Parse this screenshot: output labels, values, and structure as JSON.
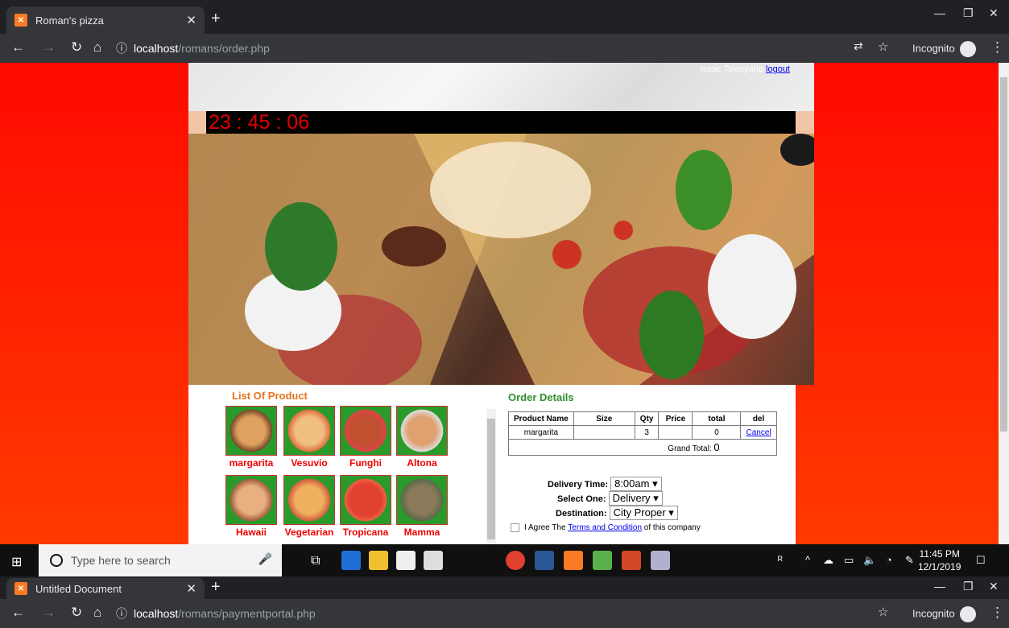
{
  "browser1": {
    "tab_title": "Roman's pizza",
    "url_host": "localhost",
    "url_path": "/romans/order.php",
    "incognito": "Incognito"
  },
  "page": {
    "user_name": "Isaac Tsienyane",
    "logout": "logout",
    "clock": "23 : 45 : 06",
    "list_title": "List Of Product",
    "products": [
      "margarita",
      "Vesuvio",
      "Funghi",
      "Altona",
      "Hawaii",
      "Vegetarian",
      "Tropicana",
      "Mamma"
    ],
    "order_title": "Order Details",
    "table_headers": [
      "Product Name",
      "Size",
      "Qty",
      "Price",
      "total",
      "del"
    ],
    "row": {
      "product": "margarita",
      "size": "",
      "qty": "3",
      "price": "",
      "total": "0",
      "del": "Cancel"
    },
    "grand_total_label": "Grand Total:",
    "grand_total_value": "0",
    "delivery_time_label": "Delivery Time:",
    "delivery_time_value": "8:00am",
    "select_one_label": "Select One:",
    "select_one_value": "Delivery",
    "destination_label": "Destination:",
    "destination_value": "City Proper",
    "agree_prefix": "I Agree The ",
    "agree_link": "Terms and Condition",
    "agree_suffix": " of this company"
  },
  "taskbar": {
    "search_placeholder": "Type here to search",
    "time": "11:45 PM",
    "date": "12/1/2019"
  },
  "browser2": {
    "tab_title": "Untitled Document",
    "url_host": "localhost",
    "url_path": "/romans/paymentportal.php",
    "incognito": "Incognito"
  },
  "colors": {
    "accent_red": "#ff0a00",
    "title_orange": "#e8731e",
    "title_green": "#2f8f2f"
  }
}
